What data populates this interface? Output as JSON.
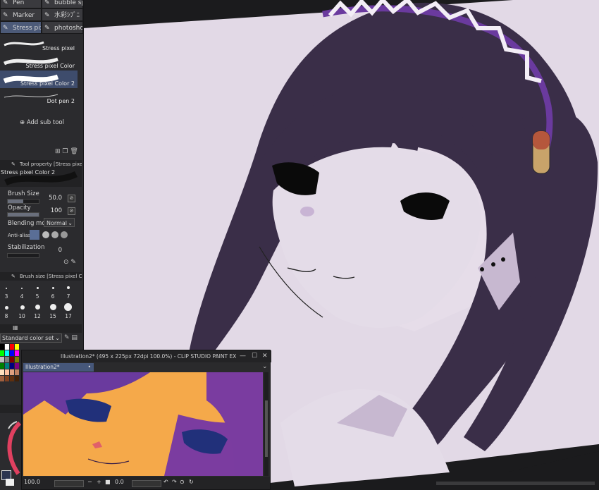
{
  "tool_tabs": [
    {
      "label": "Pen",
      "icon": "pen-icon"
    },
    {
      "label": "bubble spri",
      "icon": "brush-icon"
    },
    {
      "label": "Marker",
      "icon": "marker-icon"
    },
    {
      "label": "水彩ｼﾌﾞﾆ",
      "icon": "brush-icon"
    },
    {
      "label": "Stress pixel",
      "icon": "brush-icon",
      "selected": true
    },
    {
      "label": "photoshop",
      "icon": "brush-icon"
    }
  ],
  "sub_tools": [
    {
      "label": "Stress pixel"
    },
    {
      "label": "Stress pixel Color"
    },
    {
      "label": "Stress pixel Color 2",
      "selected": true
    },
    {
      "label": "Dot pen 2"
    }
  ],
  "add_sub_tool": "Add sub tool",
  "tool_property": {
    "header": "Tool property [Stress pixel",
    "preset_name": "Stress pixel Color 2",
    "brush_size_label": "Brush Size",
    "brush_size_value": "50.0",
    "brush_size_fraction": 0.5,
    "opacity_label": "Opacity",
    "opacity_value": "100",
    "opacity_fraction": 1.0,
    "blending_label": "Blending mode",
    "blending_value": "Normal",
    "anti_alias_label": "Anti-aliasin",
    "stabilization_label": "Stabilization",
    "stabilization_value": "0"
  },
  "brush_size_panel": {
    "header": "Brush size [Stress pixel Col",
    "sizes": [
      "3",
      "4",
      "5",
      "6",
      "7",
      "8",
      "10",
      "12",
      "15",
      "17"
    ]
  },
  "color_set": {
    "selected": "Standard color set",
    "swatches": [
      "#000000",
      "#ffffff",
      "#ff0000",
      "#ffff00",
      "#00ff00",
      "#00ffff",
      "#0000ff",
      "#ff00ff",
      "#c0c0c0",
      "#808080",
      "#800000",
      "#808000",
      "#008000",
      "#008080",
      "#000080",
      "#800080",
      "#ffe0c0",
      "#ffc0a0",
      "#e0a080",
      "#c08060",
      "#a06040",
      "#804020",
      "#603010",
      "#402008"
    ]
  },
  "navigator": {
    "title": "Illustration2* (495 x 225px 72dpi 100.0%) - CLIP STUDIO PAINT EX",
    "tab": "Illustration2*",
    "zoom": "100.0",
    "rotation": "0.0"
  },
  "colors": {
    "paper": "#e2d9e6",
    "hair": "#3a2e48",
    "headband": "#6a3a9e",
    "panel": "#2b2b2e",
    "selection": "#46577a"
  }
}
